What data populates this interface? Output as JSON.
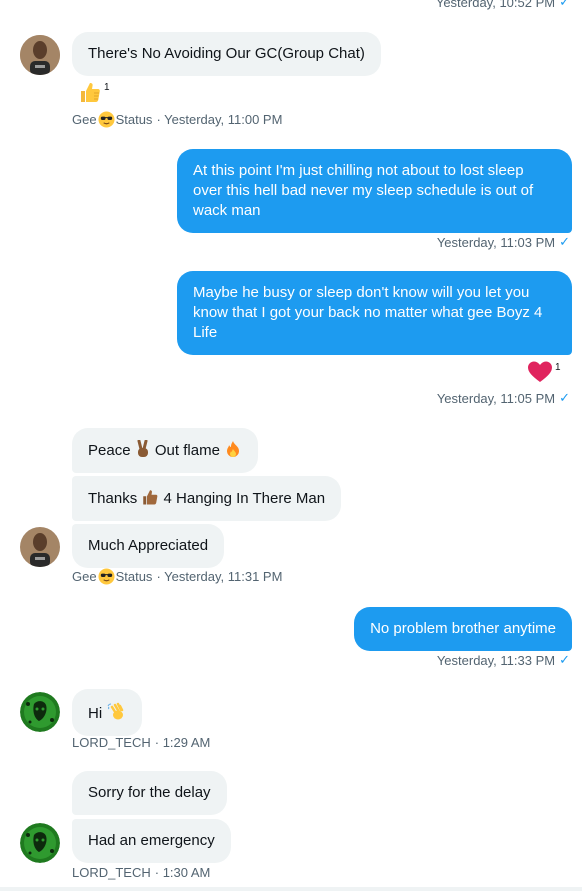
{
  "top_status": {
    "time": "Yesterday, 10:52 PM",
    "check": "✓"
  },
  "messages": {
    "m1": {
      "text": "There's No Avoiding Our GC(Group Chat)",
      "reaction_count": "1"
    },
    "meta1": {
      "sender_a": "Gee",
      "sender_b": "Status",
      "time": "· Yesterday, 11:00 PM"
    },
    "m2": {
      "text": "At this point I'm just chilling not about to lost sleep over this hell bad never my sleep schedule is out of wack man"
    },
    "meta2": {
      "time": "Yesterday, 11:03 PM",
      "check": "✓"
    },
    "m3": {
      "text": "Maybe he busy or sleep don't know will you let you know that I got your back no matter what gee Boyz 4 Life",
      "reaction_count": "1"
    },
    "meta3": {
      "time": "Yesterday, 11:05 PM",
      "check": "✓"
    },
    "m4": {
      "text_a": "Peace",
      "text_b": "Out flame"
    },
    "m5": {
      "text_a": "Thanks",
      "text_b": "4 Hanging In There Man"
    },
    "m6": {
      "text": "Much Appreciated"
    },
    "meta6": {
      "sender_a": "Gee",
      "sender_b": "Status",
      "time": "· Yesterday, 11:31 PM"
    },
    "m7": {
      "text": "No problem brother anytime"
    },
    "meta7": {
      "time": "Yesterday, 11:33 PM",
      "check": "✓"
    },
    "m8": {
      "text": "Hi"
    },
    "meta8": {
      "sender": "LORD_TECH",
      "time": "· 1:29 AM"
    },
    "m9": {
      "text": "Sorry for the delay"
    },
    "m10": {
      "text": "Had an emergency"
    },
    "meta10": {
      "sender": "LORD_TECH",
      "time": "· 1:30 AM"
    }
  },
  "icons": {
    "thumbs_up": "thumbs-up-emoji",
    "sunglasses": "sunglasses-emoji",
    "heart": "red-heart-emoji",
    "victory": "victory-hand-emoji",
    "fire": "fire-emoji",
    "waving": "waving-hand-emoji"
  },
  "colors": {
    "outgoing": "#1d9bf0",
    "incoming": "#eff3f4",
    "meta": "#536471",
    "heart": "#e0245e"
  }
}
